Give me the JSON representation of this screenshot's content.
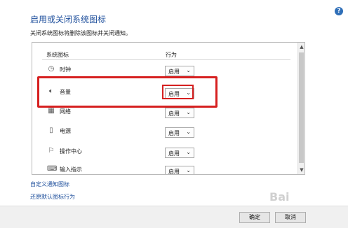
{
  "title": "启用或关闭系统图标",
  "subtitle": "关闭系统图标将删除该图标并关闭通知。",
  "help_glyph": "?",
  "table": {
    "col_icons": "系统图标",
    "col_behavior": "行为",
    "rows": [
      {
        "icon": "clock-icon",
        "label": "时钟",
        "value": "启用"
      },
      {
        "icon": "volume-icon",
        "label": "音量",
        "value": "启用"
      },
      {
        "icon": "network-icon",
        "label": "网络",
        "value": "启用"
      },
      {
        "icon": "power-icon",
        "label": "电源",
        "value": "启用"
      },
      {
        "icon": "action-center-icon",
        "label": "操作中心",
        "value": "启用"
      },
      {
        "icon": "input-indicator-icon",
        "label": "输入指示",
        "value": "启用"
      }
    ]
  },
  "links": {
    "customize": "自定义通知图标",
    "restore": "还原默认图标行为"
  },
  "buttons": {
    "ok": "确定",
    "cancel": "取消"
  },
  "watermark": "Bai"
}
